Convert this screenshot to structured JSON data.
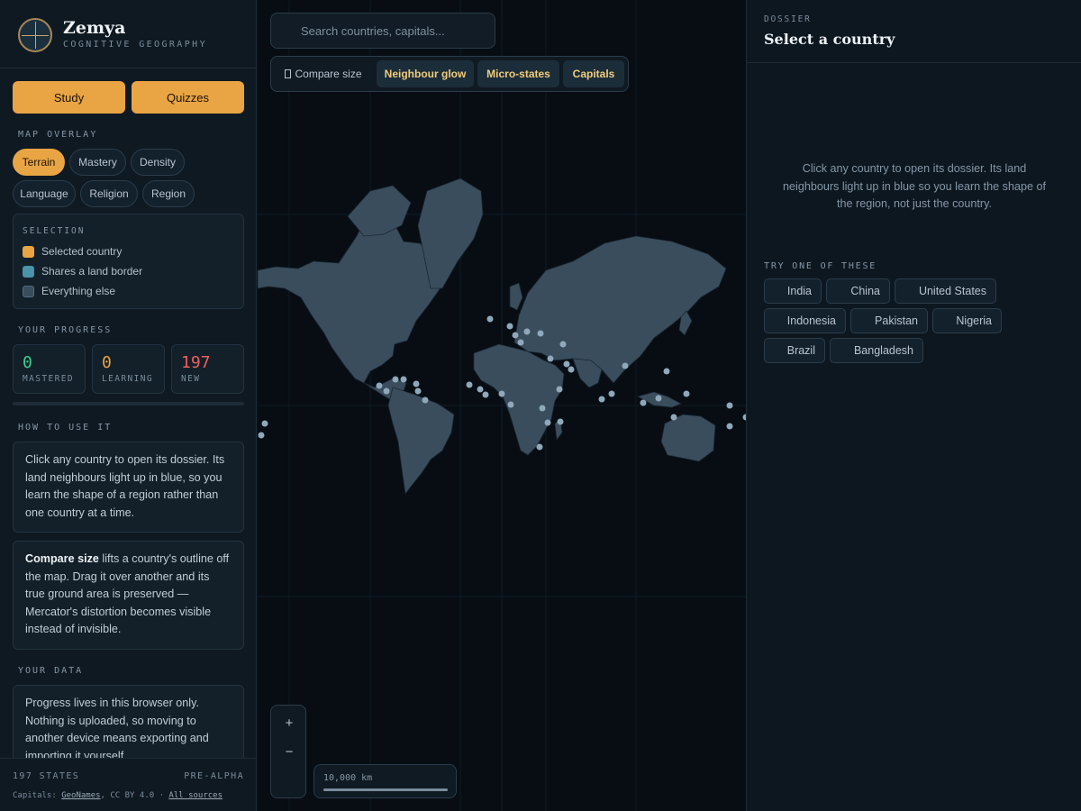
{
  "brand": {
    "name": "Zemya",
    "subtitle": "COGNITIVE GEOGRAPHY",
    "logo_icon": "globe-icon"
  },
  "actions": {
    "study": "Study",
    "quizzes": "Quizzes"
  },
  "overlay": {
    "label": "MAP OVERLAY",
    "options": [
      "Terrain",
      "Mastery",
      "Density",
      "Language",
      "Religion",
      "Region"
    ],
    "active": "Terrain"
  },
  "selection_legend": {
    "label": "SELECTION",
    "items": [
      {
        "text": "Selected country",
        "color": "#e9a444"
      },
      {
        "text": "Shares a land border",
        "color": "#4a93a8"
      },
      {
        "text": "Everything else",
        "color": "#3a4d5d"
      }
    ]
  },
  "progress": {
    "label": "YOUR PROGRESS",
    "mastered": {
      "value": "0",
      "label": "MASTERED",
      "color": "#3ecf8e"
    },
    "learning": {
      "value": "0",
      "label": "LEARNING",
      "color": "#e9a444"
    },
    "new": {
      "value": "197",
      "label": "NEW",
      "color": "#ef5f5f"
    },
    "fraction_mastered": 0
  },
  "how_to": {
    "label": "HOW TO USE IT",
    "card1": "Click any country to open its dossier. Its land neighbours light up in blue, so you learn the shape of a region rather than one country at a time.",
    "card2_strong": "Compare size",
    "card2_rest": " lifts a country's outline off the map. Drag it over another and its true ground area is preserved — Mercator's distortion becomes visible instead of invisible."
  },
  "your_data": {
    "label": "YOUR DATA",
    "card": "Progress lives in this browser only. Nothing is uploaded, so moving to another device means exporting and importing it yourself."
  },
  "footer": {
    "states": "197 STATES",
    "stage": "PRE-ALPHA",
    "credit_prefix": "Capitals: ",
    "credit_source": "GeoNames",
    "credit_license": ", CC BY 4.0 · ",
    "credit_all": "All sources"
  },
  "map": {
    "search": {
      "placeholder": "Search countries, capitals..."
    },
    "toolbar": {
      "compare": "Compare size",
      "compare_icon": "compare-icon",
      "neighbour_glow": "Neighbour glow",
      "micro_states": "Micro-states",
      "capitals": "Capitals"
    },
    "zoom": {
      "in": "+",
      "out": "−"
    },
    "scale_label": "10,000 km",
    "land_color": "#3a4d5d",
    "ocean_color": "#070d13",
    "dot_color": "#8fa9bb"
  },
  "dossier": {
    "kicker": "DOSSIER",
    "title": "Select a country",
    "empty_text": "Click any country to open its dossier. Its land neighbours light up in blue so you learn the shape of the region, not just the country.",
    "try_label": "TRY ONE OF THESE",
    "suggestions": [
      "India",
      "China",
      "United States",
      "Indonesia",
      "Pakistan",
      "Nigeria",
      "Brazil",
      "Bangladesh"
    ]
  }
}
